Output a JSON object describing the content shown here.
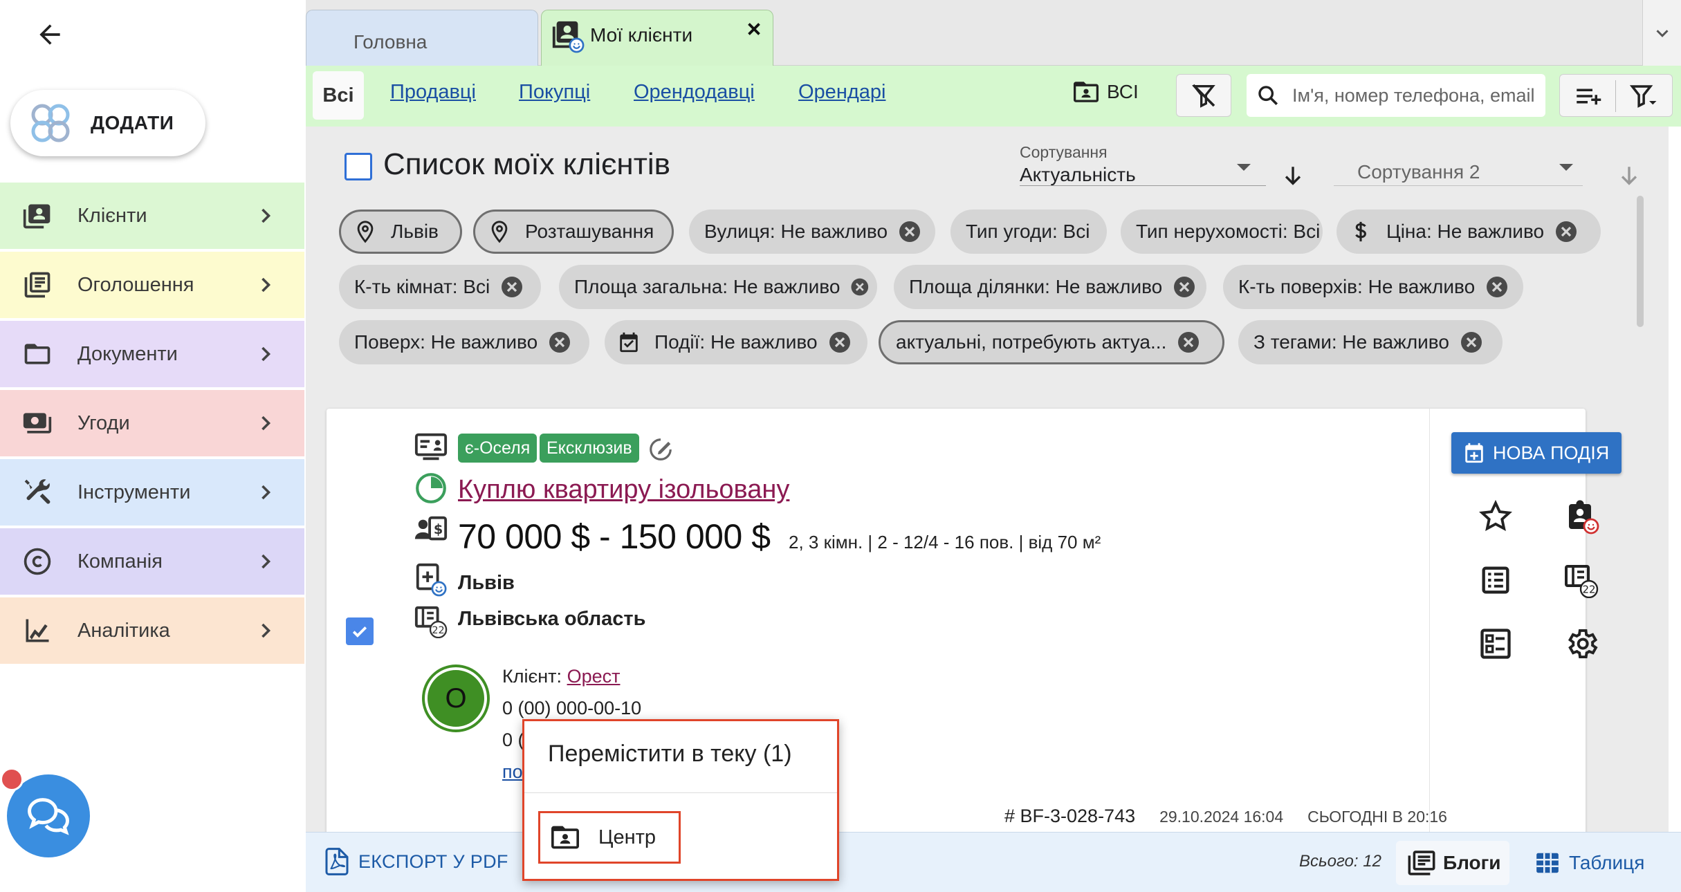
{
  "sidebar": {
    "add_label": "ДОДАТИ",
    "items": [
      {
        "label": "Клієнти",
        "bg": "#dcf7d3",
        "icon": "contacts-icon"
      },
      {
        "label": "Оголошення",
        "bg": "#fdfbcf",
        "icon": "newspaper-icon"
      },
      {
        "label": "Документи",
        "bg": "#e6dbf8",
        "icon": "folder-icon"
      },
      {
        "label": "Угоди",
        "bg": "#f9d6d6",
        "icon": "money-icon"
      },
      {
        "label": "Інструменти",
        "bg": "#d9e8fb",
        "icon": "tools-icon"
      },
      {
        "label": "Компанія",
        "bg": "#dcd7f7",
        "icon": "copyright-icon"
      },
      {
        "label": "Аналітика",
        "bg": "#fce5d1",
        "icon": "analytics-icon"
      }
    ]
  },
  "tabs": {
    "home": "Головна",
    "clients": "Мої клієнти"
  },
  "filters": {
    "all": "Всі",
    "links": [
      "Продавці",
      "Покупці",
      "Орендодавці",
      "Орендарі"
    ],
    "folder_label": "ВСІ",
    "search_placeholder": "Ім'я, номер телефона, email"
  },
  "list": {
    "title": "Список моїх клієнтів",
    "sort1_caption": "Сортування",
    "sort1_value": "Актуальність",
    "sort2_caption": "Сортування 2"
  },
  "chips": [
    {
      "text": "Львів",
      "icon": "location-pin-icon",
      "outlined": true,
      "close": false
    },
    {
      "text": "Розташування",
      "icon": "location-pin-icon",
      "outlined": true,
      "close": false
    },
    {
      "text": "Вулиця: Не важливо",
      "icon": null,
      "outlined": false,
      "close": true
    },
    {
      "text": "Тип угоди: Всі",
      "icon": null,
      "outlined": false,
      "close": false
    },
    {
      "text": "Тип нерухомості: Всі",
      "icon": null,
      "outlined": false,
      "close": false
    },
    {
      "text": "Ціна: Не важливо",
      "icon": "dollar-icon",
      "outlined": false,
      "close": true
    },
    {
      "text": "К-ть кімнат: Всі",
      "icon": null,
      "outlined": false,
      "close": true
    },
    {
      "text": "Площа загальна: Не важливо",
      "icon": null,
      "outlined": false,
      "close": true
    },
    {
      "text": "Площа ділянки: Не важливо",
      "icon": null,
      "outlined": false,
      "close": true
    },
    {
      "text": "К-ть поверхів: Не важливо",
      "icon": null,
      "outlined": false,
      "close": true
    },
    {
      "text": "Поверх: Не важливо",
      "icon": null,
      "outlined": false,
      "close": true
    },
    {
      "text": "Події: Не важливо",
      "icon": "calendar-check-icon",
      "outlined": false,
      "close": true
    },
    {
      "text": "актуальні, потребують актуа...",
      "icon": null,
      "outlined": true,
      "close": true
    },
    {
      "text": "З тегами: Не важливо",
      "icon": null,
      "outlined": false,
      "close": true
    }
  ],
  "listing": {
    "badges": [
      "є-Оселя",
      "Ексклюзив"
    ],
    "title": "Куплю квартиру ізольовану",
    "price": "70 000 $ - 150 000 $",
    "params": "2, 3 кімн. | 2 - 12/4 - 16 пов. | від 70 м²",
    "city": "Львів",
    "region": "Львівська область",
    "avatar_letter": "О",
    "client_label": "Клієнт:",
    "client_name": "Орест",
    "phone1": "0 (00) 000-00-10",
    "phone2_visible": "0 (",
    "more_visible": "по",
    "id": "# BF-3-028-743",
    "created": "29.10.2024 16:04",
    "updated": "СЬОГОДНІ В 20:16",
    "counter": "22",
    "new_event_label": "НОВА ПОДІЯ"
  },
  "bottom": {
    "export_label": "ЕКСПОРТ У PDF",
    "total": "Всього: 12",
    "blogs_label": "Блоги",
    "table_label": "Таблиця"
  },
  "popup": {
    "title": "Перемістити в теку (1)",
    "item_label": "Центр"
  },
  "colors": {
    "accent_blue": "#2f72c4",
    "link_purple": "#8b1a52",
    "badge_green": "#3b9f5c",
    "highlight_red": "#e0452a"
  }
}
